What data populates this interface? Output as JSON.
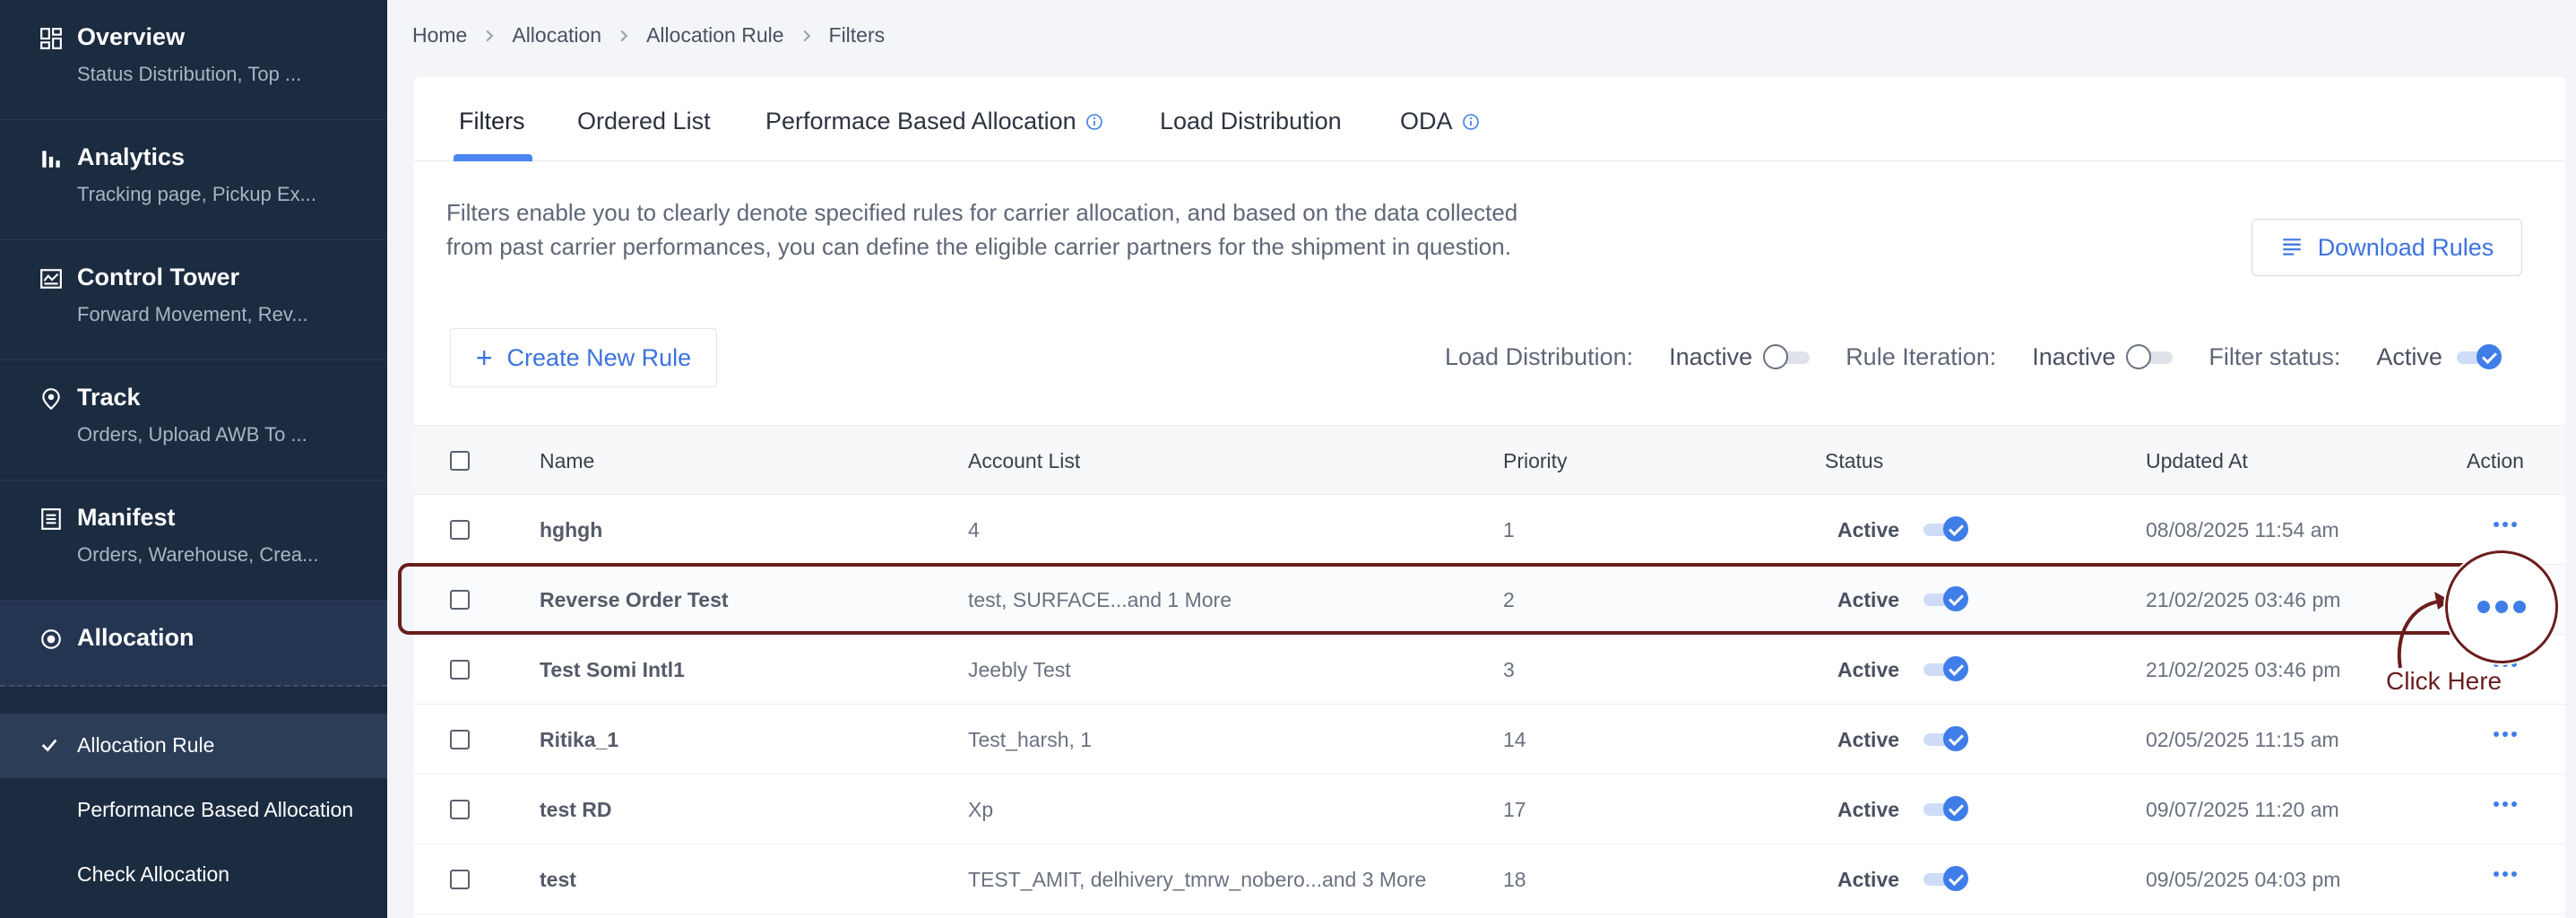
{
  "sidebar": {
    "items": [
      {
        "title": "Overview",
        "subtitle": "Status Distribution, Top ..."
      },
      {
        "title": "Analytics",
        "subtitle": "Tracking page, Pickup Ex..."
      },
      {
        "title": "Control Tower",
        "subtitle": "Forward Movement, Rev..."
      },
      {
        "title": "Track",
        "subtitle": "Orders, Upload AWB To ..."
      },
      {
        "title": "Manifest",
        "subtitle": "Orders, Warehouse, Crea..."
      },
      {
        "title": "Allocation",
        "subtitle": ""
      }
    ],
    "subitems": [
      {
        "label": "Allocation Rule"
      },
      {
        "label": "Performance Based Allocation"
      },
      {
        "label": "Check Allocation"
      }
    ]
  },
  "breadcrumb": [
    "Home",
    "Allocation",
    "Allocation Rule",
    "Filters"
  ],
  "tabs": [
    {
      "label": "Filters"
    },
    {
      "label": "Ordered List"
    },
    {
      "label": "Performace Based Allocation"
    },
    {
      "label": "Load Distribution"
    },
    {
      "label": "ODA"
    }
  ],
  "description": "Filters enable you to clearly denote specified rules for carrier allocation, and based on the data collected from past carrier performances, you can define the eligible carrier partners for the shipment in question.",
  "download_button": "Download Rules",
  "create_button": "Create New Rule",
  "toggles": {
    "load_distribution": {
      "label": "Load Distribution:",
      "value": "Inactive"
    },
    "rule_iteration": {
      "label": "Rule Iteration:",
      "value": "Inactive"
    },
    "filter_status": {
      "label": "Filter status:",
      "value": "Active"
    }
  },
  "table": {
    "columns": [
      "Name",
      "Account List",
      "Priority",
      "Status",
      "Updated At",
      "Action"
    ],
    "rows": [
      {
        "name": "hghgh",
        "accounts": "4",
        "priority": "1",
        "status": "Active",
        "updated": "08/08/2025 11:54 am"
      },
      {
        "name": "Reverse Order Test",
        "accounts": "test, SURFACE...and 1 More",
        "priority": "2",
        "status": "Active",
        "updated": "21/02/2025 03:46 pm"
      },
      {
        "name": "Test Somi Intl1",
        "accounts": "Jeebly Test",
        "priority": "3",
        "status": "Active",
        "updated": "21/02/2025 03:46 pm"
      },
      {
        "name": "Ritika_1",
        "accounts": "Test_harsh, 1",
        "priority": "14",
        "status": "Active",
        "updated": "02/05/2025 11:15 am"
      },
      {
        "name": "test RD",
        "accounts": "Xp",
        "priority": "17",
        "status": "Active",
        "updated": "09/07/2025 11:20 am"
      },
      {
        "name": "test",
        "accounts": "TEST_AMIT, delhivery_tmrw_nobero...and 3 More",
        "priority": "18",
        "status": "Active",
        "updated": "09/05/2025 04:03 pm"
      }
    ]
  },
  "annotation": {
    "text": "Click Here"
  },
  "colors": {
    "accent": "#3f7ee8",
    "sidebar_bg": "#1b2b40",
    "annotation": "#6b1d1d"
  }
}
